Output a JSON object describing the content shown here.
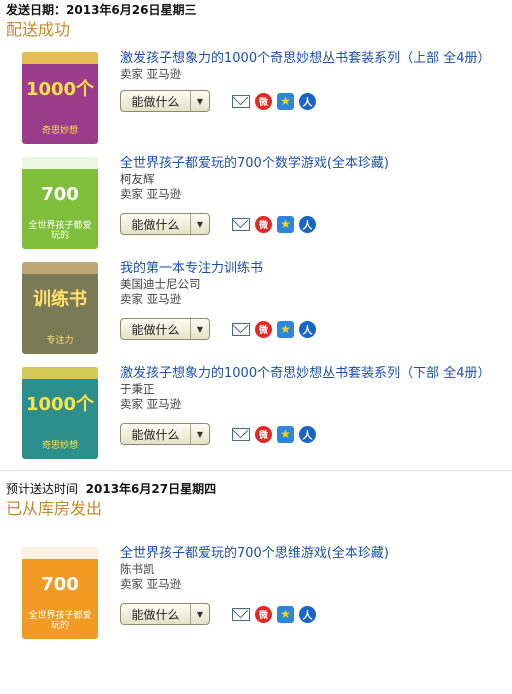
{
  "sections": [
    {
      "date_label": "发送日期：",
      "date_value": "2013年6月26日星期三",
      "status": "配送成功"
    },
    {
      "date_label": "预计送达时间",
      "date_value": "2013年6月27日星期四",
      "status": "已从库房发出"
    }
  ],
  "button_label": "能做什么",
  "items": [
    {
      "title": "激发孩子想象力的1000个奇思妙想丛书套装系列（上部 全4册）",
      "author": "",
      "seller": "卖家 亚马逊",
      "cover_text": "奇思妙想",
      "cover_num": "1000个",
      "colors": {
        "bg": "#9b3d8a",
        "top": "#f2d34a",
        "text": "#ffe14a"
      }
    },
    {
      "title": "全世界孩子都爱玩的700个数学游戏(全本珍藏)",
      "author": "柯友辉",
      "seller": "卖家 亚马逊",
      "cover_text": "全世界孩子都爱玩的",
      "cover_num": "700",
      "colors": {
        "bg": "#7fbf3c",
        "top": "#ffffff",
        "text": "#ffffff"
      }
    },
    {
      "title": "我的第一本专注力训练书",
      "author": "美国迪士尼公司",
      "seller": "卖家 亚马逊",
      "cover_text": "专注力",
      "cover_num": "训练书",
      "colors": {
        "bg": "#7b7a56",
        "top": "#c9b27a",
        "text": "#ffe46b"
      }
    },
    {
      "title": "激发孩子想象力的1000个奇思妙想丛书套装系列（下部 全4册）",
      "author": "于秉正",
      "seller": "卖家 亚马逊",
      "cover_text": "奇思妙想",
      "cover_num": "1000个",
      "colors": {
        "bg": "#2c8f8c",
        "top": "#f2d34a",
        "text": "#ffe14a"
      }
    },
    {
      "title": "全世界孩子都爱玩的700个思维游戏(全本珍藏)",
      "author": "陈书凯",
      "seller": "卖家 亚马逊",
      "cover_text": "全世界孩子都爱玩的",
      "cover_num": "700",
      "colors": {
        "bg": "#f19a24",
        "top": "#ffffff",
        "text": "#ffffff"
      }
    }
  ],
  "share_icons": [
    "mail-icon",
    "weibo-icon",
    "qzone-icon",
    "renren-icon"
  ],
  "accent_color": "#c8882a",
  "link_color": "#1e4fa8"
}
